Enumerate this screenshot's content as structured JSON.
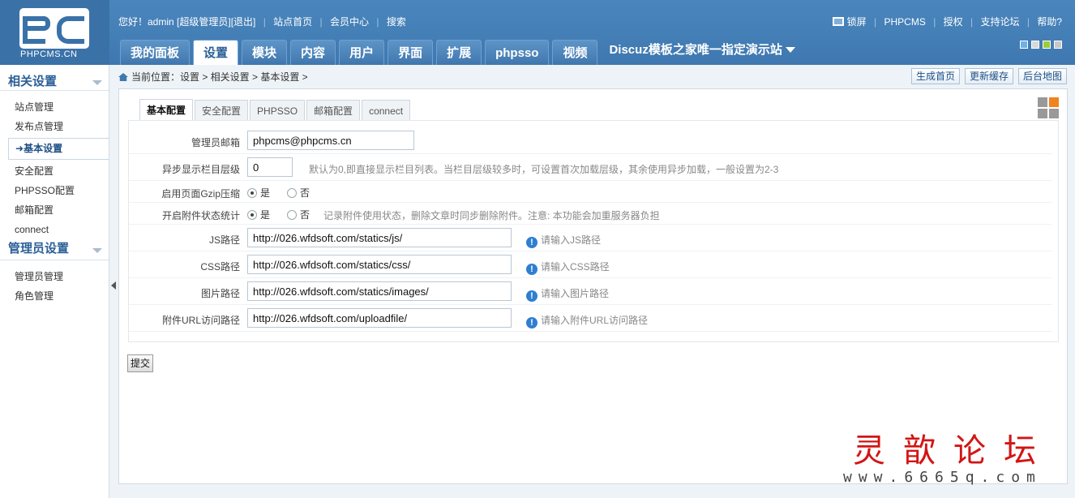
{
  "logo_text": "PHPCMS.CN",
  "top": {
    "greeting": "您好！admin [超级管理员]",
    "logout": "[退出]",
    "site_home": "站点首页",
    "member_center": "会员中心",
    "search": "搜索",
    "lock_screen": "锁屏",
    "phpcms": "PHPCMS",
    "license": "授权",
    "forum": "支持论坛",
    "help": "帮助?"
  },
  "skin_colors": [
    "#6fb0e8",
    "#d9d9d9",
    "#9ccc3c",
    "#c8c8c8"
  ],
  "nav": {
    "tabs": [
      "我的面板",
      "设置",
      "模块",
      "内容",
      "用户",
      "界面",
      "扩展",
      "phpsso",
      "视频"
    ],
    "active": "设置",
    "site_name": "Discuz模板之家唯一指定演示站"
  },
  "sidebar": {
    "section1_title": "相关设置",
    "section1_items": [
      "站点管理",
      "发布点管理",
      "基本设置",
      "安全配置",
      "PHPSSO配置",
      "邮箱配置",
      "connect"
    ],
    "section2_title": "管理员设置",
    "section2_items": [
      "管理员管理",
      "角色管理"
    ]
  },
  "breadcrumb": "当前位置：设置 > 相关设置 > 基本设置 >",
  "actions": [
    "生成首页",
    "更新缓存",
    "后台地图"
  ],
  "tabs": [
    "基本配置",
    "安全配置",
    "PHPSSO",
    "邮箱配置",
    "connect"
  ],
  "form": {
    "admin_email": {
      "label": "管理员邮箱",
      "value": "phpcms@phpcms.cn"
    },
    "async_level": {
      "label": "异步显示栏目层级",
      "value": "0",
      "hint": "默认为0,即直接显示栏目列表。当栏目层级较多时，可设置首次加载层级，其余使用异步加载，一般设置为2-3"
    },
    "gzip": {
      "label": "启用页面Gzip压缩",
      "yes": "是",
      "no": "否"
    },
    "attach_stat": {
      "label": "开启附件状态统计",
      "yes": "是",
      "no": "否",
      "hint": "记录附件使用状态，删除文章时同步删除附件。注意: 本功能会加重服务器负担"
    },
    "js_path": {
      "label": "JS路径",
      "value": "http://026.wfdsoft.com/statics/js/",
      "hint": "请输入JS路径"
    },
    "css_path": {
      "label": "CSS路径",
      "value": "http://026.wfdsoft.com/statics/css/",
      "hint": "请输入CSS路径"
    },
    "img_path": {
      "label": "图片路径",
      "value": "http://026.wfdsoft.com/statics/images/",
      "hint": "请输入图片路径"
    },
    "upload_url": {
      "label": "附件URL访问路径",
      "value": "http://026.wfdsoft.com/uploadfile/",
      "hint": "请输入附件URL访问路径"
    }
  },
  "submit_label": "提交",
  "watermark": {
    "title": "灵歆论坛",
    "url": "www.6665q.com"
  }
}
